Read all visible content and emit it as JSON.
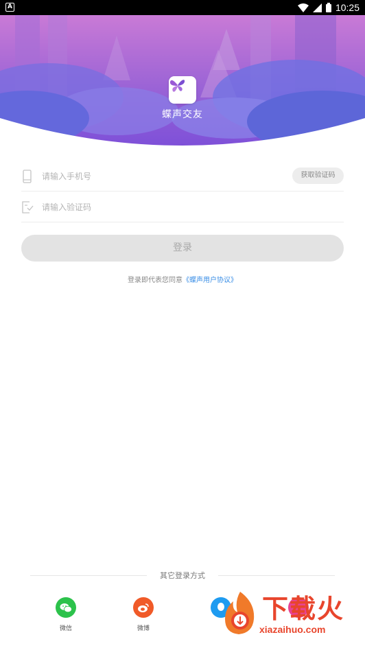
{
  "status_bar": {
    "app_icon": "A",
    "time": "10:25",
    "icons": [
      "wifi-icon",
      "signal-icon",
      "battery-icon"
    ]
  },
  "hero": {
    "app_name": "蝶声交友",
    "logo_icon": "butterfly-icon",
    "colors": {
      "purple_top": "#b06ad0",
      "purple_bottom": "#7c4fd8"
    }
  },
  "form": {
    "phone": {
      "placeholder": "请输入手机号",
      "value": "",
      "icon": "phone-icon"
    },
    "get_code_label": "获取验证码",
    "code": {
      "placeholder": "请输入验证码",
      "value": "",
      "icon": "verify-code-icon"
    },
    "login_label": "登录",
    "agreement_prefix": "登录即代表您同意",
    "agreement_link": "《蝶声用户协议》"
  },
  "other_login": {
    "title": "其它登录方式",
    "providers": [
      {
        "label": "微信",
        "icon": "wechat-icon",
        "color": "#2cc24b"
      },
      {
        "label": "微博",
        "icon": "weibo-icon",
        "color": "#f05a28"
      },
      {
        "label": "",
        "icon": "qq-icon",
        "color": "#1e9bf0"
      },
      {
        "label": "",
        "icon": "other-login-icon",
        "color": "#e84393"
      }
    ]
  },
  "watermark": {
    "text": "下载火",
    "url": "xiazaihuo.com"
  }
}
